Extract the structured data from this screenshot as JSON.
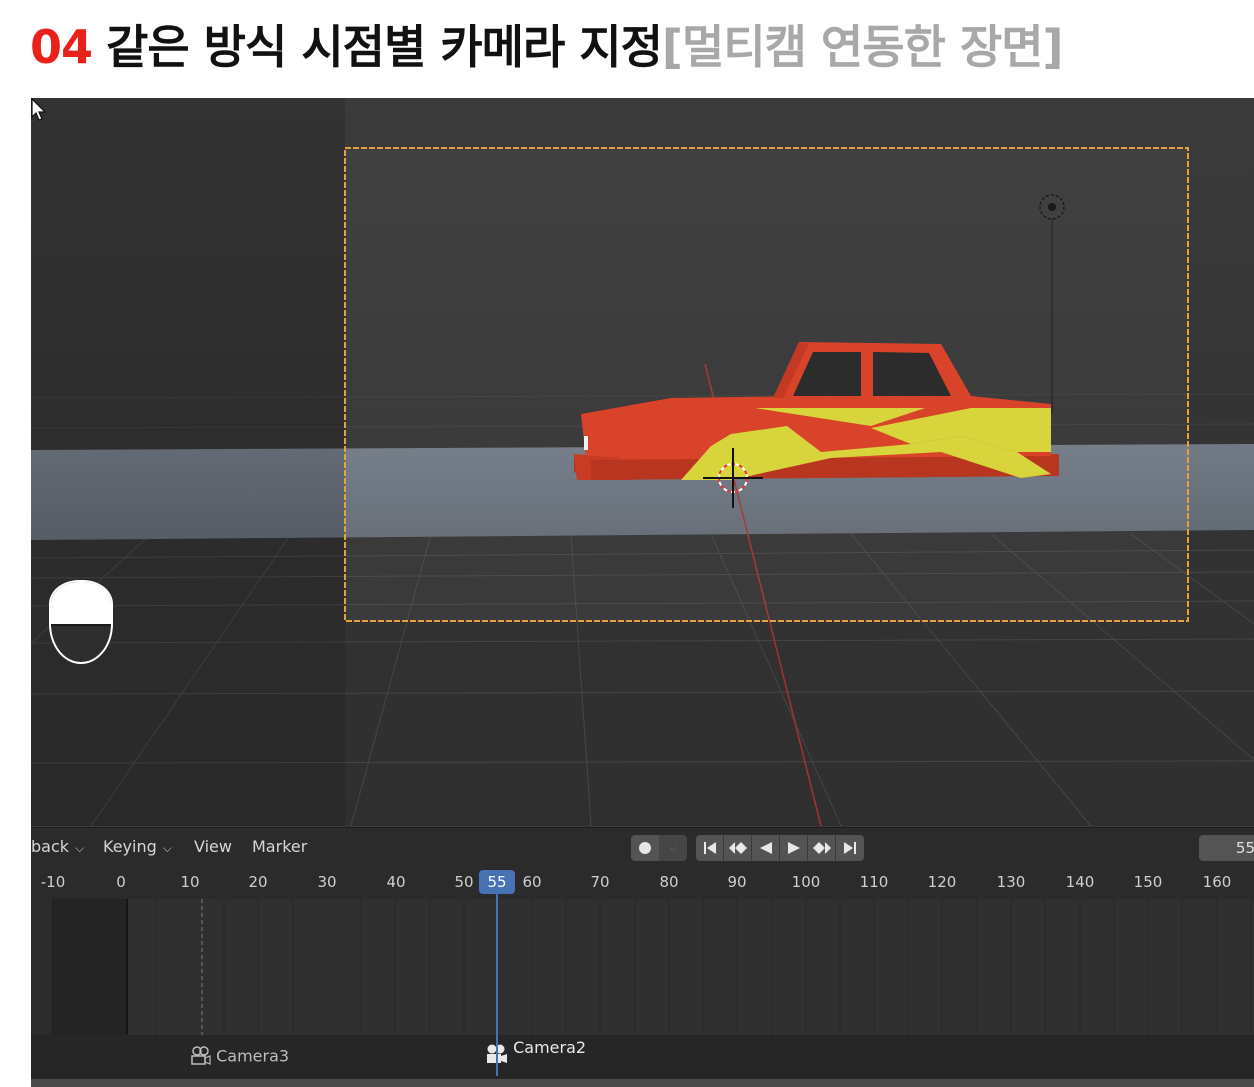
{
  "heading": {
    "number": "04",
    "title": "같은 방식 시점별 카메라 지정",
    "subtitle": "[멀티캠 연동한 장면]",
    "colors": {
      "number": "#e8211a",
      "title": "#111111",
      "subtitle": "#a8a8a8"
    }
  },
  "viewport": {
    "camera_frame_color": "#e3a33a",
    "car_colors": {
      "body": "#d9432a",
      "stripe": "#d8d43c",
      "windows": "#2c2c2c"
    },
    "icons": [
      "camera-view-gizmo-icon",
      "light-icon",
      "3d-cursor-icon",
      "mouse-pointer-icon"
    ]
  },
  "timeline": {
    "menus": [
      {
        "label": "back",
        "has_dropdown": true
      },
      {
        "label": "Keying",
        "has_dropdown": true
      },
      {
        "label": "View",
        "has_dropdown": false
      },
      {
        "label": "Marker",
        "has_dropdown": false
      }
    ],
    "playback_buttons": [
      "jump-start-icon",
      "prev-keyframe-icon",
      "play-reverse-icon",
      "play-icon",
      "next-keyframe-icon",
      "jump-end-icon"
    ],
    "current_frame_field": "55",
    "ruler_ticks": [
      "-10",
      "0",
      "10",
      "20",
      "30",
      "40",
      "50",
      "60",
      "70",
      "80",
      "90",
      "100",
      "110",
      "120",
      "130",
      "140",
      "150",
      "160"
    ],
    "current_frame": "55",
    "playhead_color": "#4772b3",
    "markers": [
      {
        "label": "Camera3",
        "frame": 12,
        "active": false
      },
      {
        "label": "Camera2",
        "frame": 55,
        "active": true
      }
    ]
  }
}
